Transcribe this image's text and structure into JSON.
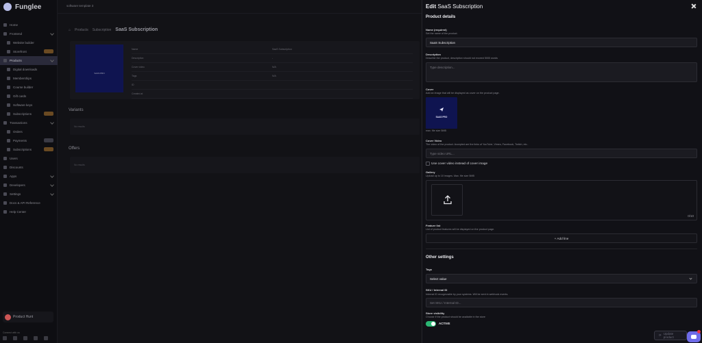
{
  "sidebar": {
    "brand": "Funglee",
    "items": [
      {
        "label": "Home",
        "sub": false
      },
      {
        "label": "Frontend",
        "sub": false,
        "chevron": true
      },
      {
        "label": "Website builder",
        "sub": true
      },
      {
        "label": "Storefront",
        "sub": true,
        "badge": "orange"
      },
      {
        "label": "Products",
        "sub": false,
        "active": true,
        "chevron": true
      },
      {
        "label": "Digital downloads",
        "sub": true
      },
      {
        "label": "Memberships",
        "sub": true
      },
      {
        "label": "Course builder",
        "sub": true
      },
      {
        "label": "Gift cards",
        "sub": true
      },
      {
        "label": "Software keys",
        "sub": true
      },
      {
        "label": "Subscriptions",
        "sub": true,
        "badge": "orange"
      },
      {
        "label": "Transactions",
        "sub": false,
        "chevron": true
      },
      {
        "label": "Orders",
        "sub": true
      },
      {
        "label": "Payments",
        "sub": true,
        "badge": "gray"
      },
      {
        "label": "Subscriptions",
        "sub": true,
        "badge": "orange"
      },
      {
        "label": "Users",
        "sub": false
      },
      {
        "label": "Discounts",
        "sub": false
      },
      {
        "label": "Apps",
        "sub": false,
        "chevron": true
      },
      {
        "label": "Developers",
        "sub": false,
        "chevron": true
      },
      {
        "label": "Settings",
        "sub": false,
        "chevron": true
      },
      {
        "label": "Docs & API Reference",
        "sub": false
      },
      {
        "label": "Help Center",
        "sub": false
      }
    ],
    "product_hunt": "Product Hunt",
    "connect": "Connect with us"
  },
  "main": {
    "project": "software template 3",
    "crumbs": [
      "Products",
      "Subscription"
    ],
    "heading": "SaaS Subscription",
    "image_text": "SAAS PRO",
    "kv_rows": [
      [
        "Name",
        "SaaS Subscription"
      ],
      [
        "Description",
        "-"
      ],
      [
        "Cover video",
        "N/A"
      ],
      [
        "Tags",
        "N/A"
      ],
      [
        "ID",
        ""
      ],
      [
        "Created at",
        ""
      ]
    ],
    "variants_title": "Variants",
    "variants_empty": "No results",
    "offers_title": "Offers",
    "offers_empty": "No results"
  },
  "drawer": {
    "title_prefix": "Edit",
    "title_name": "SaaS Subscription",
    "product_details": "Product details",
    "name_label": "Name (required)",
    "name_hint": "Set the name of the product.",
    "name_value": "SaaS Subscription",
    "desc_label": "Description",
    "desc_hint": "Describe the product, description should not exceed 5000 words",
    "desc_placeholder": "Type description...",
    "cover_label": "Cover",
    "cover_hint": "Add an image that will be displayed as cover on the product page.",
    "cover_image_text": "SAAS PRO",
    "cover_max": "max. file size 5MB",
    "video_label": "Cover Video",
    "video_hint": "The video of the product. Accepted are the links of YouTube, Vimeo, Facebook, Twitch, etc..",
    "video_placeholder": "Type video URL...",
    "use_video_label": "Use cover video instead of cover image",
    "gallery_label": "Gallery",
    "gallery_hint": "Upload up to 10 images. Max. file size 5MB",
    "gallery_count": "0/10",
    "features_label": "Feature list",
    "features_hint": "List of product features will be displayed on the product page.",
    "add_line": "+ Add line",
    "other_settings": "Other settings",
    "tags_label": "Tags",
    "tags_value": "Select value",
    "sku_label": "SKU / Internal ID",
    "sku_hint": "Internal ID recognizable by your systems. Will be sent in webhook events.",
    "sku_placeholder": "Set SKU / Internal ID...",
    "visibility_label": "Store visibility",
    "visibility_hint": "Choose if the product should be available in the store",
    "visibility_value": "ACTIVE",
    "update_button": "Update product"
  },
  "colors": {
    "accent_green": "#2bb673",
    "chat_purple": "#6e6be8",
    "cover_navy": "#0f1450"
  }
}
